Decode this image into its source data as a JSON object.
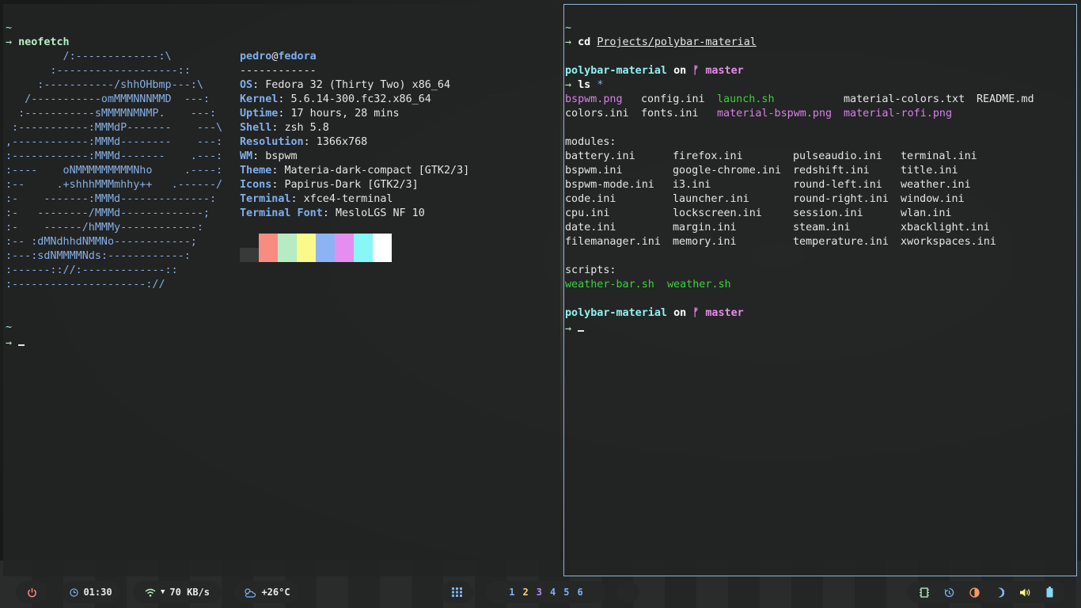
{
  "colors": {
    "accent_blue": "#7fb0ee",
    "border_focus": "#8fb4d8",
    "green_exec": "#3bd23b",
    "magenta": "#d782e6",
    "workspace_active": "#f5d27a"
  },
  "left_terminal": {
    "prompt_tilde": "~",
    "prompt_arrow": "→",
    "command": "neofetch",
    "art_lines": [
      "         /:-------------:\\",
      "       :-------------------::",
      "     :-----------/shhOHbmp---:\\",
      "   /-----------omMMMNNNMMD  ---:",
      "  :-----------sMMMMNMNMP.    ---:",
      " :-----------:MMMdP-------    ---\\",
      ",------------:MMMd--------    ---:",
      ":------------:MMMd-------    .---:",
      ":----    oNMMMMMMMMMNho     .----:",
      ":--     .+shhhMMMmhhy++   .------/",
      ":-    -------:MMMd--------------:",
      ":-   --------/MMMd-------------;",
      ":-    ------/hMMMy------------:",
      ":-- :dMNdhhdNMMNo------------;",
      ":---:sdNMMMMNds:------------:",
      ":------:://:-------------::",
      ":---------------------://"
    ],
    "user": "pedro",
    "at": "@",
    "host": "fedora",
    "separator": "------------",
    "info": [
      {
        "key": "OS",
        "value": "Fedora 32 (Thirty Two) x86_64"
      },
      {
        "key": "Kernel",
        "value": "5.6.14-300.fc32.x86_64"
      },
      {
        "key": "Uptime",
        "value": "17 hours, 28 mins"
      },
      {
        "key": "Shell",
        "value": "zsh 5.8"
      },
      {
        "key": "Resolution",
        "value": "1366x768"
      },
      {
        "key": "WM",
        "value": "bspwm"
      },
      {
        "key": "Theme",
        "value": "Materia-dark-compact [GTK2/3]"
      },
      {
        "key": "Icons",
        "value": "Papirus-Dark [GTK2/3]"
      },
      {
        "key": "Terminal",
        "value": "xfce4-terminal"
      },
      {
        "key": "Terminal Font",
        "value": "MesloLGS NF 10"
      }
    ],
    "swatch_colors": [
      "#383a39",
      "#f98c82",
      "#b6ebc3",
      "#fbf98a",
      "#8cb4f5",
      "#e68ef0",
      "#87f7f7",
      "#ffffff"
    ]
  },
  "right_terminal": {
    "prompt_tilde": "~",
    "prompt_arrow": "→",
    "cd_command": "cd",
    "cd_path": "Projects/polybar-material",
    "dir_name": "polybar-material",
    "on_word": "on",
    "branch_icon": "ᚠ",
    "branch": "master",
    "ls_command": "ls",
    "ls_glob": "*",
    "files_row1": [
      {
        "name": "bspwm.png",
        "color": "m"
      },
      {
        "name": "config.ini",
        "color": "w"
      },
      {
        "name": "launch.sh",
        "color": "g"
      },
      {
        "name": "material-colors.txt",
        "color": "w"
      },
      {
        "name": "README.md",
        "color": "w"
      }
    ],
    "files_row2": [
      {
        "name": "colors.ini",
        "color": "w"
      },
      {
        "name": "fonts.ini",
        "color": "w"
      },
      {
        "name": "material-bspwm.png",
        "color": "m"
      },
      {
        "name": "material-rofi.png",
        "color": "m"
      }
    ],
    "modules_header": "modules:",
    "modules": [
      [
        "battery.ini",
        "firefox.ini",
        "pulseaudio.ini",
        "terminal.ini"
      ],
      [
        "bspwm.ini",
        "google-chrome.ini",
        "redshift.ini",
        "title.ini"
      ],
      [
        "bspwm-mode.ini",
        "i3.ini",
        "round-left.ini",
        "weather.ini"
      ],
      [
        "code.ini",
        "launcher.ini",
        "round-right.ini",
        "window.ini"
      ],
      [
        "cpu.ini",
        "lockscreen.ini",
        "session.ini",
        "wlan.ini"
      ],
      [
        "date.ini",
        "margin.ini",
        "steam.ini",
        "xbacklight.ini"
      ],
      [
        "filemanager.ini",
        "memory.ini",
        "temperature.ini",
        "xworkspaces.ini"
      ]
    ],
    "scripts_header": "scripts:",
    "scripts": [
      "weather-bar.sh",
      "weather.sh"
    ]
  },
  "polybar": {
    "time": "01:30",
    "net_speed": "70 KB/s",
    "weather": "+26°C",
    "workspaces": [
      {
        "label": "1",
        "state": "normal"
      },
      {
        "label": "2",
        "state": "active"
      },
      {
        "label": "3",
        "state": "occupied"
      },
      {
        "label": "4",
        "state": "normal"
      },
      {
        "label": "5",
        "state": "normal"
      },
      {
        "label": "6",
        "state": "normal"
      }
    ],
    "icons": {
      "power": "power-icon",
      "clock": "clock-icon",
      "wifi": "wifi-icon",
      "weather": "partly-cloudy-icon",
      "launcher": "apps-grid-icon",
      "memory": "memory-chip-icon",
      "timer": "timer-icon",
      "redshift": "redshift-icon",
      "theme": "moon-icon",
      "volume": "volume-icon",
      "battery": "battery-icon"
    }
  }
}
